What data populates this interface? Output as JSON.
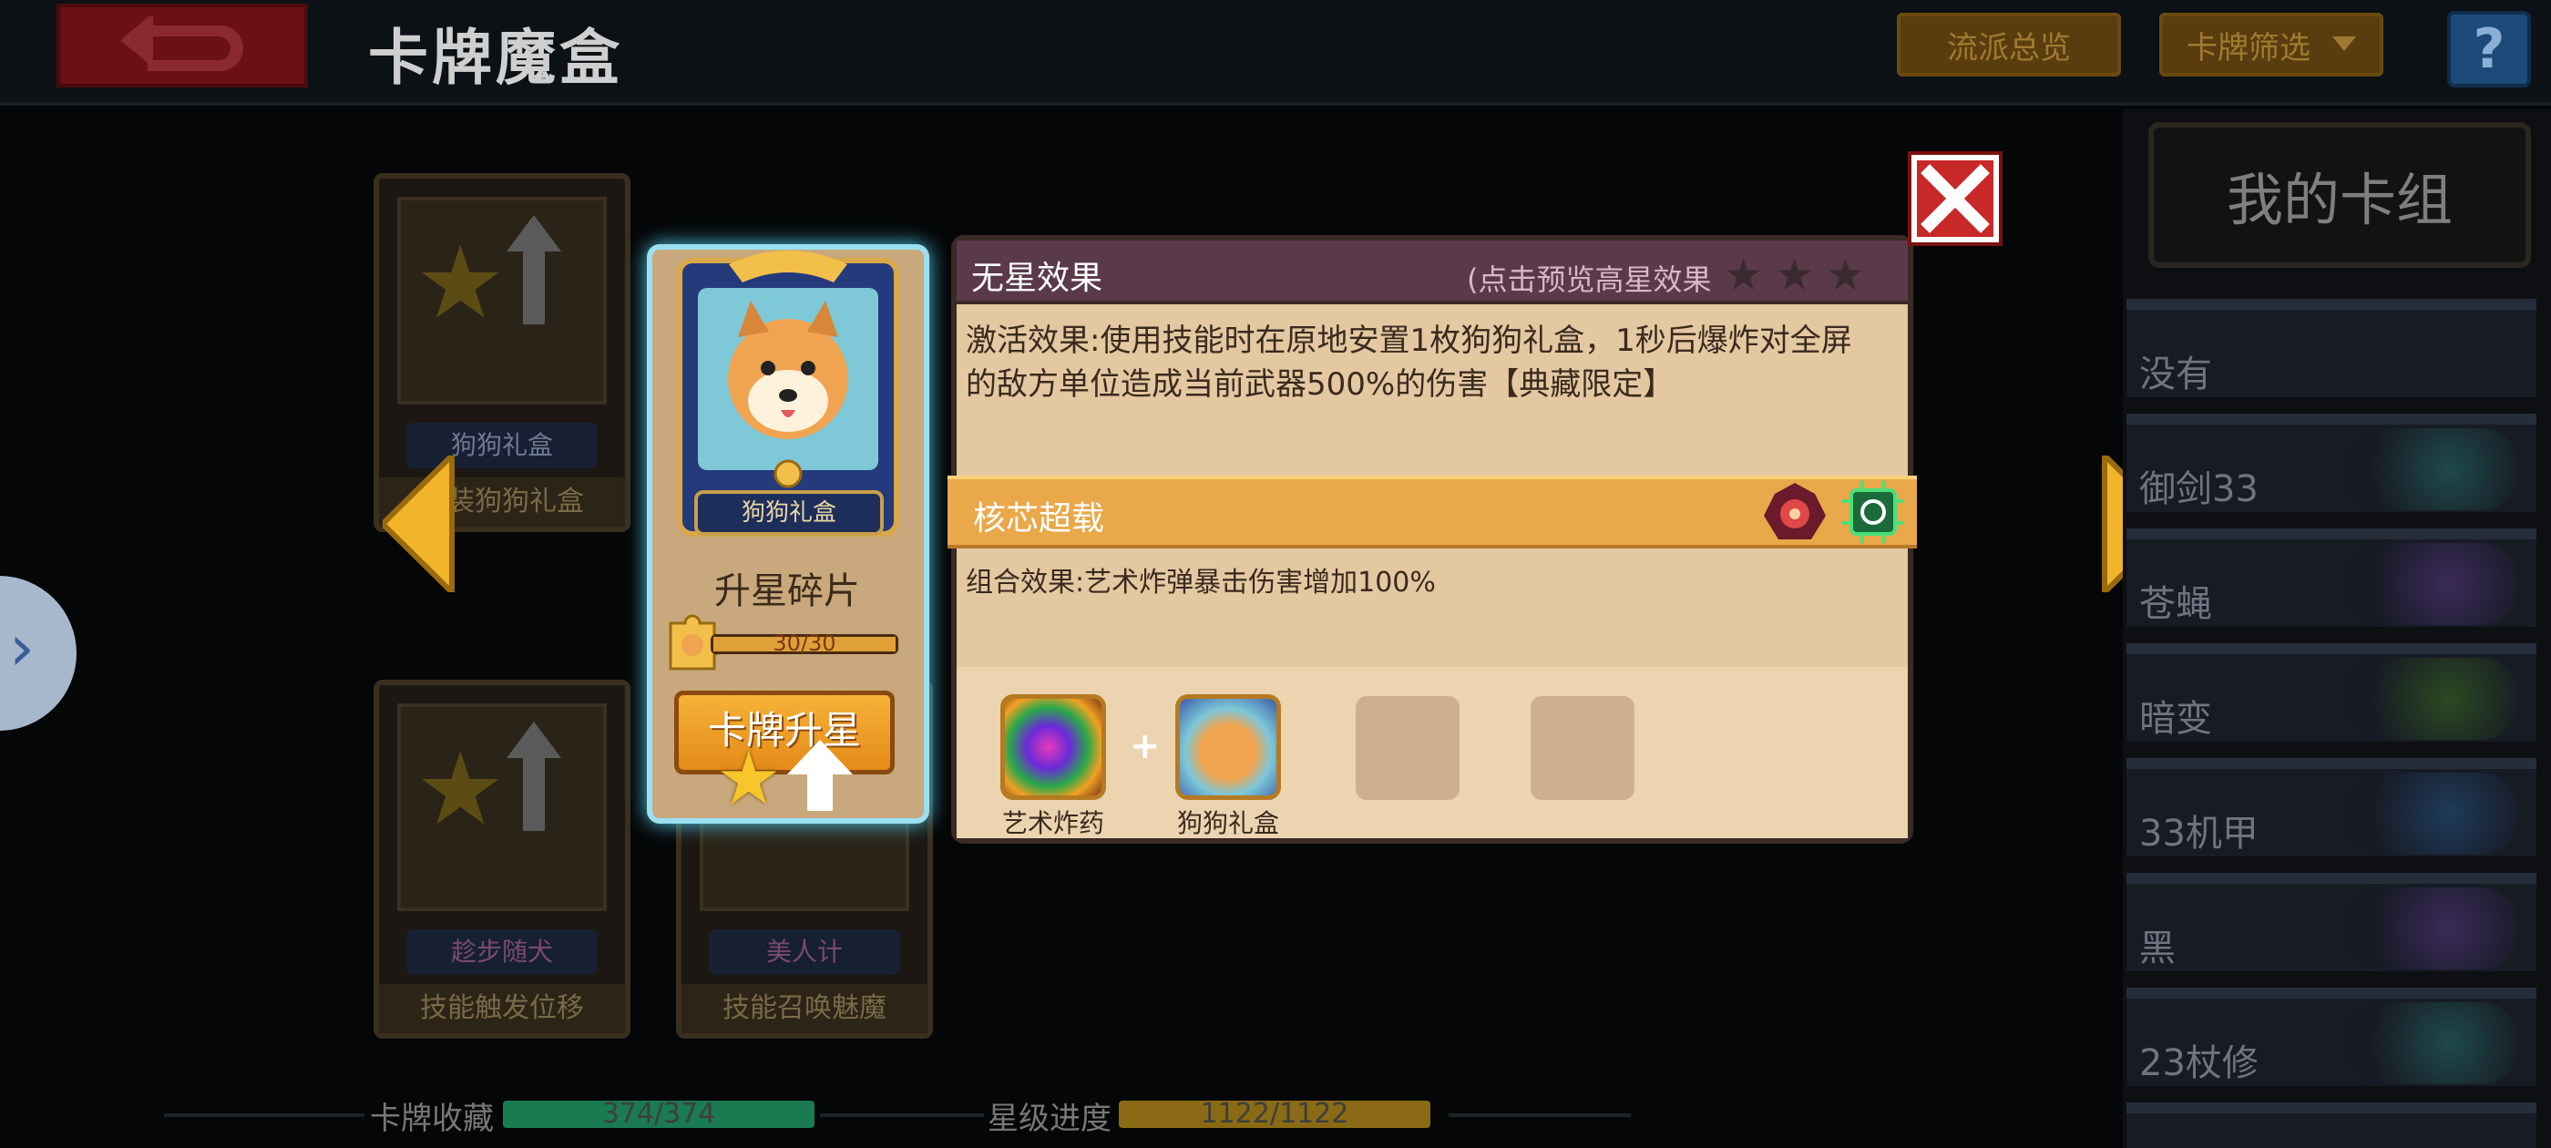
{
  "header": {
    "title": "卡牌魔盒",
    "genre_overview_label": "流派总览",
    "card_filter_label": "卡牌筛选",
    "help_label": "?"
  },
  "background_cards": [
    {
      "name": "狗狗礼盒",
      "footer": "安装狗狗礼盒"
    },
    {
      "name": "趁步随犬",
      "footer": "技能触发位移"
    },
    {
      "name": "美人计",
      "footer": "技能召唤魅魔"
    }
  ],
  "focused_card": {
    "name": "狗狗礼盒",
    "shard_title": "升星碎片",
    "shard_progress": "30/30",
    "shard_fraction": 1.0,
    "upgrade_label": "卡牌升星"
  },
  "detail": {
    "header_title": "无星效果",
    "header_hint": "(点击预览高星效果",
    "stars_filled": 0,
    "stars_total": 3,
    "description": "激活效果:使用技能时在原地安置1枚狗狗礼盒，1秒后爆炸对全屏的敌方单位造成当前武器500%的伤害【典藏限定】",
    "core_title": "核芯超载",
    "combo_description": "组合效果:艺术炸弹暴击伤害增加100%",
    "combo_slots": [
      {
        "label": "艺术炸药",
        "icon": "art-bomb-icon"
      },
      {
        "label": "狗狗礼盒",
        "icon": "dog-gift-box-icon"
      }
    ],
    "empty_slots": 2,
    "plus_sign": "+"
  },
  "deck": {
    "title": "我的卡组",
    "items": [
      "没有",
      "御剑33",
      "苍蝇",
      "暗变",
      "33机甲",
      "黑",
      "23杖修"
    ]
  },
  "status": {
    "collection_label": "卡牌收藏",
    "collection_value": "374/374",
    "collection_fraction": 1.0,
    "star_label": "星级进度",
    "star_value": "1122/1122",
    "star_fraction": 1.0
  },
  "colors": {
    "accent_gold": "#e9a84a",
    "panel_bg": "#e3c8a2",
    "header_purple": "#5a3a4a",
    "focus_glow": "#9ae0f0",
    "close_red": "#c82828"
  }
}
